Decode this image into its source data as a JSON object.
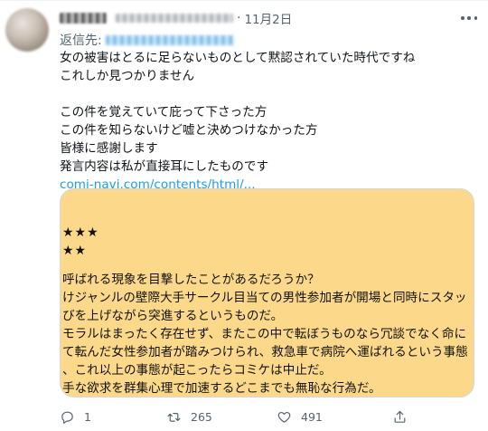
{
  "header": {
    "separator": "·",
    "date": "11月2日"
  },
  "reply": {
    "prefix": "返信先:"
  },
  "body": {
    "lines": [
      "女の被害はとるに足らないものとして黙認されていた時代ですね",
      "これしか見つかりません",
      "",
      "この件を覚えていて庇って下さった方",
      "この件を知らないけど嘘と決めつけなかった方",
      "皆様に感謝します",
      "発言内容は私が直接耳にしたものです"
    ],
    "link": "comi-navi.com/contents/html/..."
  },
  "card": {
    "background": "#fcd98a",
    "stars1": "★★★",
    "stars2": "★★",
    "lines": [
      "呼ばれる現象を目撃したことがあるだろうか？",
      "けジャンルの壁際大手サークル目当ての男性参加者が開場と同時にスタッ",
      "びを上げながら突進するというものだ。",
      "モラルはまったく存在せず、またこの中で転ぼうものなら冗談でなく命に",
      "て転んだ女性参加者が踏みつけられ、救急車で病院へ運ばれるという事態",
      "、これ以上の事態が起こったらコミケは中止だ。",
      "手な欲求を群集心理で加速するどこまでも無恥な行為だ。"
    ]
  },
  "actions": {
    "reply_icon": "comment-icon",
    "reply_count": "1",
    "retweet_icon": "retweet-icon",
    "retweet_count": "265",
    "like_icon": "heart-icon",
    "like_count": "491",
    "share_icon": "share-icon"
  }
}
